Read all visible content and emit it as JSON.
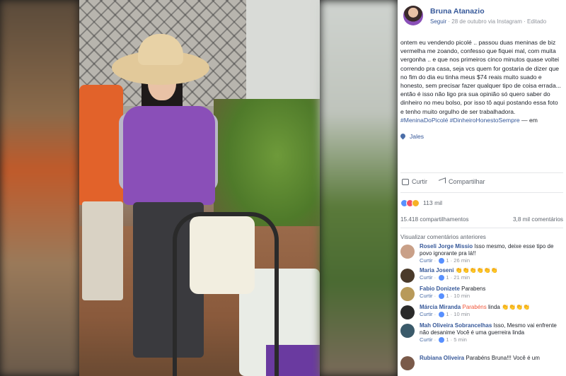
{
  "post": {
    "author": "Bruna Atanazio",
    "follow": "Seguir",
    "date": "28 de outubro via Instagram",
    "edited": "Editado",
    "separator": "·",
    "text": "ontem eu vendendo picolé .. passou duas meninas de biz vermelha me zoando, confesso que fiquei mal, com muita vergonha .. e que nos primeiros cinco minutos quase voltei correndo pra casa, seja vcs quem for gostaria de dizer que no fim do dia eu tinha meus $74 reais muito suado e honesto, sem precisar fazer qualquer tipo de coisa errada... então é isso não ligo pra sua opinião só quero saber do dinheiro no meu bolso, por isso tô aqui postando essa foto e tenho muito orgulho de ser trabalhadora.",
    "hashtags": "#MeninaDoPicolé #DinheiroHonestoSempre",
    "em": "— em",
    "location": "Jales"
  },
  "actions": {
    "like": "Curtir",
    "share": "Compartilhar"
  },
  "engagement": {
    "reactions": "113 mil",
    "shares": "15.418 compartilhamentos",
    "comments": "3,8 mil comentários",
    "previous_comments": "Visualizar comentários anteriores"
  },
  "comments": [
    {
      "name": "Roseli Jorge Missio",
      "text": "Isso mesmo, deixe esse tipo de povo ignorante pra lá!!",
      "like": "Curtir",
      "count": "1",
      "time": "26 min",
      "avatar_color": "#c9a088"
    },
    {
      "name": "Maria Joseni",
      "text": "👏👏👏👏👏👏",
      "like": "Curtir",
      "count": "1",
      "time": "21 min",
      "avatar_color": "#4a3a2a"
    },
    {
      "name": "Fabio Donizete",
      "text": "Parabens",
      "like": "Curtir",
      "count": "1",
      "time": "10 min",
      "avatar_color": "#b89a5a"
    },
    {
      "name": "Márcia Miranda",
      "text_highlight": "Parabéns",
      "text": "linda 👏👏👏👏",
      "like": "Curtir",
      "count": "1",
      "time": "10 min",
      "avatar_color": "#2a2a2a"
    },
    {
      "name": "Mah Oliveira Sobrancelhas",
      "text": "Isso, Mesmo vai enfrente não desanime Você é uma guerreira linda",
      "like": "Curtir",
      "count": "1",
      "time": "5 min",
      "avatar_color": "#3a5a6a"
    },
    {
      "name": "Rubiana Oliveira",
      "text": "Parabéns Bruna!!! Você é um",
      "avatar_color": "#7a5a4a"
    }
  ]
}
